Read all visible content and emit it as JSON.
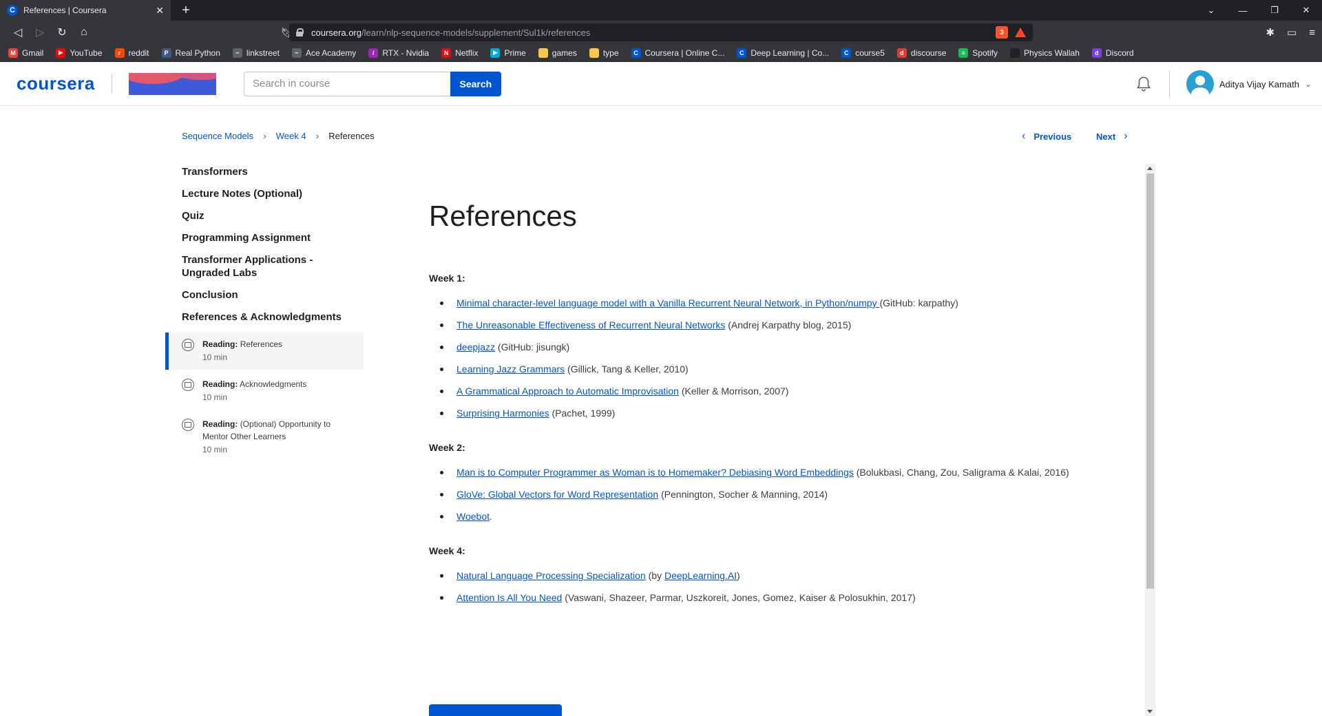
{
  "browser": {
    "tab_title": "References | Coursera",
    "favicon": "C",
    "new_tab": "+",
    "url_domain": "coursera.org",
    "url_path": "/learn/nlp-sequence-models/supplement/Sul1k/references",
    "brave_badge": "3",
    "bookmarks": [
      {
        "label": "Gmail",
        "icon": "M",
        "color": "#ea4335"
      },
      {
        "label": "YouTube",
        "icon": "▶",
        "color": "#ff0000"
      },
      {
        "label": "reddit",
        "icon": "r",
        "color": "#ff4500"
      },
      {
        "label": "Real Python",
        "icon": "P",
        "color": "#3d5a80"
      },
      {
        "label": "linkstreet",
        "icon": "~",
        "color": "#5f6368"
      },
      {
        "label": "Ace Academy",
        "icon": "~",
        "color": "#5f6368"
      },
      {
        "label": "RTX - Nvidia",
        "icon": "/",
        "color": "#9c27b0"
      },
      {
        "label": "Netflix",
        "icon": "N",
        "color": "#e50914"
      },
      {
        "label": "Prime",
        "icon": "▶",
        "color": "#00a8e1"
      },
      {
        "label": "games",
        "icon": "",
        "color": "#f9c74f"
      },
      {
        "label": "type",
        "icon": "",
        "color": "#f9c74f"
      },
      {
        "label": "Coursera | Online C...",
        "icon": "C",
        "color": "#0056d2"
      },
      {
        "label": "Deep Learning | Co...",
        "icon": "C",
        "color": "#0056d2"
      },
      {
        "label": "course5",
        "icon": "C",
        "color": "#0056d2"
      },
      {
        "label": "discourse",
        "icon": "d",
        "color": "#e53935"
      },
      {
        "label": "Spotify",
        "icon": "≡",
        "color": "#1db954"
      },
      {
        "label": "Physics Wallah",
        "icon": "",
        "color": "#222222"
      },
      {
        "label": "Discord",
        "icon": "d",
        "color": "#7b3fe4"
      }
    ]
  },
  "header": {
    "logo": "coursera",
    "search_placeholder": "Search in course",
    "search_button": "Search",
    "username": "Aditya Vijay Kamath"
  },
  "breadcrumb": {
    "course": "Sequence Models",
    "week": "Week 4",
    "current": "References"
  },
  "nav": {
    "previous": "Previous",
    "next": "Next"
  },
  "sidebar": {
    "items": [
      "Transformers",
      "Lecture Notes (Optional)",
      "Quiz",
      "Programming Assignment",
      "Transformer Applications - Ungraded Labs",
      "Conclusion",
      "References & Acknowledgments"
    ],
    "subitems": [
      {
        "type": "Reading:",
        "title": "References",
        "duration": "10 min"
      },
      {
        "type": "Reading:",
        "title": "Acknowledgments",
        "duration": "10 min"
      },
      {
        "type": "Reading:",
        "title": "(Optional) Opportunity to Mentor Other Learners",
        "duration": "10 min"
      }
    ]
  },
  "main": {
    "title": "References",
    "weeks": [
      {
        "heading": "Week 1:",
        "refs": [
          {
            "link": "Minimal character-level language model with a Vanilla Recurrent Neural Network, in Python/numpy ",
            "note": "(GitHub: karpathy)"
          },
          {
            "link": "The Unreasonable Effectiveness of Recurrent Neural Networks",
            "note": " (Andrej Karpathy blog, 2015)"
          },
          {
            "link": "deepjazz",
            "note": " (GitHub: jisungk)"
          },
          {
            "link": "Learning Jazz Grammars",
            "note": " (Gillick, Tang & Keller, 2010)"
          },
          {
            "link": "A Grammatical Approach to Automatic Improvisation",
            "note": " (Keller & Morrison, 2007)"
          },
          {
            "link": "Surprising Harmonies",
            "note": " (Pachet, 1999)"
          }
        ]
      },
      {
        "heading": "Week 2:",
        "refs": [
          {
            "link": "Man is to Computer Programmer as Woman is to Homemaker? Debiasing Word Embeddings",
            "note": " (Bolukbasi, Chang, Zou, Saligrama & Kalai, 2016)"
          },
          {
            "link": "GloVe: Global Vectors for Word Representation",
            "note": " (Pennington, Socher & Manning, 2014)"
          },
          {
            "link": "Woebot",
            "note": "."
          }
        ]
      },
      {
        "heading": "Week 4:",
        "refs": [
          {
            "link": "Natural Language Processing Specialization",
            "note": " (by ",
            "link2": "DeepLearning.AI",
            "note2": ")"
          },
          {
            "link": "Attention Is All You Need",
            "note": " (Vaswani, Shazeer, Parmar, Uszkoreit, Jones, Gomez, Kaiser & Polosukhin, 2017)"
          }
        ]
      }
    ]
  }
}
